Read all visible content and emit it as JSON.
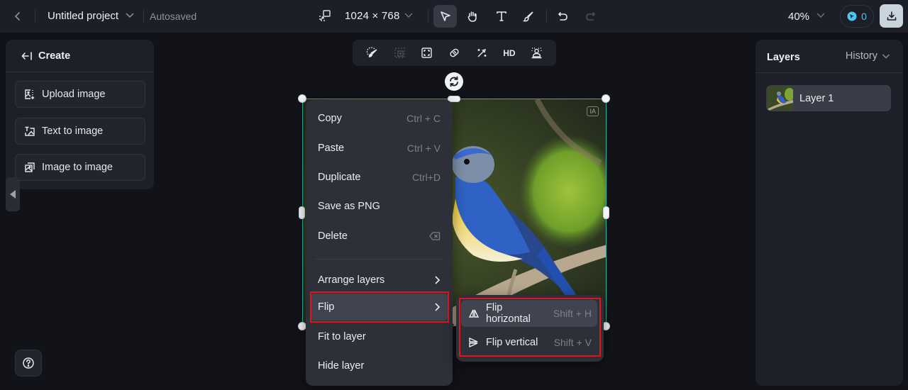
{
  "topbar": {
    "back_icon": "chevron-left-icon",
    "project_title": "Untitled project",
    "save_status": "Autosaved",
    "canvas_size": "1024 × 768",
    "tools": [
      {
        "name": "select",
        "icon": "pointer-icon",
        "active": true
      },
      {
        "name": "pan",
        "icon": "hand-icon",
        "active": false
      },
      {
        "name": "text",
        "icon": "text-icon",
        "active": false
      },
      {
        "name": "brush",
        "icon": "brush-icon",
        "active": false
      },
      {
        "name": "undo",
        "icon": "undo-icon",
        "active": false
      },
      {
        "name": "redo",
        "icon": "redo-icon",
        "active": false,
        "disabled": true
      }
    ],
    "zoom_level": "40%",
    "credits": "0",
    "download_icon": "download-icon"
  },
  "create_panel": {
    "title": "Create",
    "buttons": [
      {
        "label": "Upload image",
        "icon": "upload-image-icon"
      },
      {
        "label": "Text to image",
        "icon": "text-to-image-icon"
      },
      {
        "label": "Image to image",
        "icon": "image-to-image-icon"
      }
    ]
  },
  "image_toolbar": {
    "tools": [
      {
        "name": "inpaint",
        "icon": "lasso-brush-icon"
      },
      {
        "name": "expand",
        "icon": "expand-frame-icon",
        "disabled": true
      },
      {
        "name": "crop",
        "icon": "crop-frame-icon"
      },
      {
        "name": "eraser",
        "icon": "eraser-icon"
      },
      {
        "name": "magic",
        "icon": "magic-wand-icon"
      },
      {
        "name": "upscale",
        "label": "HD"
      },
      {
        "name": "remove-background",
        "icon": "person-cutout-icon"
      }
    ]
  },
  "image": {
    "badge": "IA",
    "description": "Blue and yellow bird perched on a branch"
  },
  "context_menu": {
    "items": [
      {
        "label": "Copy",
        "shortcut": "Ctrl + C"
      },
      {
        "label": "Paste",
        "shortcut": "Ctrl + V"
      },
      {
        "label": "Duplicate",
        "shortcut": "Ctrl+D"
      },
      {
        "label": "Save as PNG",
        "shortcut": ""
      },
      {
        "label": "Delete",
        "shortcut_icon": "backspace-icon"
      },
      {
        "label": "Arrange layers",
        "submenu": true
      },
      {
        "label": "Flip",
        "submenu": true,
        "highlighted": true
      },
      {
        "label": "Fit to layer"
      },
      {
        "label": "Hide layer"
      }
    ]
  },
  "flip_submenu": {
    "items": [
      {
        "label": "Flip horizontal",
        "shortcut": "Shift + H",
        "icon": "flip-horizontal-icon"
      },
      {
        "label": "Flip vertical",
        "shortcut": "Shift + V",
        "icon": "flip-vertical-icon"
      }
    ]
  },
  "layers_panel": {
    "title": "Layers",
    "history_label": "History",
    "layers": [
      {
        "name": "Layer 1"
      }
    ]
  },
  "colors": {
    "accent_selection": "#1fb8a6",
    "highlight": "#e1141e",
    "credits": "#48c7f0"
  }
}
